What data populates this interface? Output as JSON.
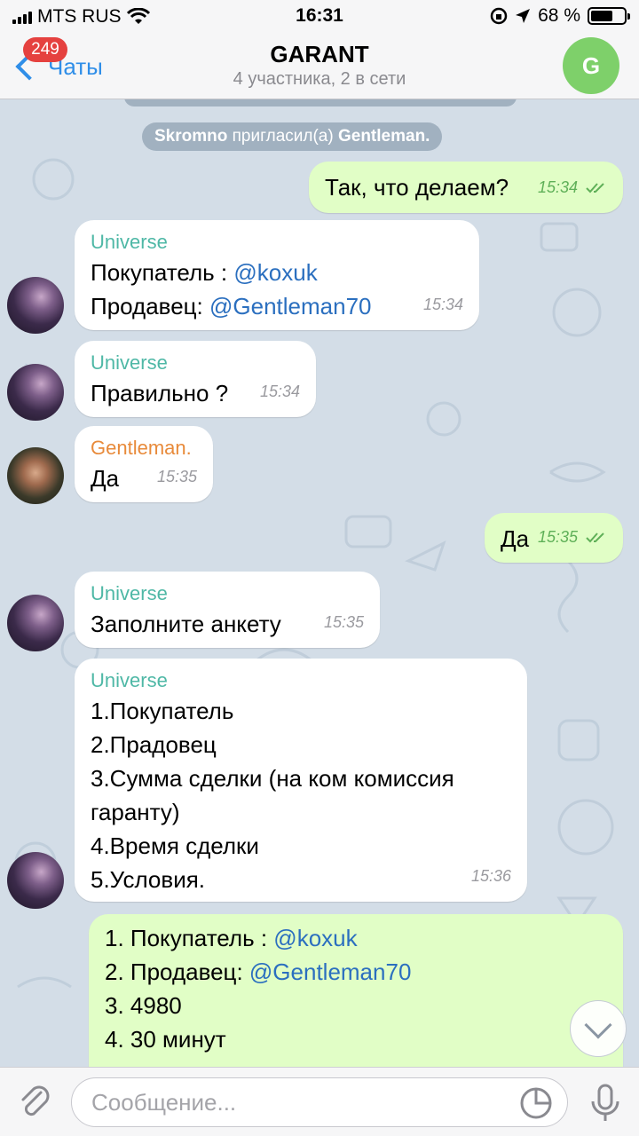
{
  "status_bar": {
    "carrier": "MTS RUS",
    "time": "16:31",
    "battery": "68 %",
    "battery_level": 0.68
  },
  "header": {
    "back_label": "Чаты",
    "unread_count": "249",
    "title": "GARANT",
    "subtitle": "4 участника, 2 в сети",
    "avatar_letter": "G",
    "avatar_color": "#7ed06a"
  },
  "service_messages": [
    {
      "actor": "Skromno",
      "action": "пригласил(а)",
      "target": "Gentleman."
    }
  ],
  "messages": [
    {
      "direction": "out",
      "text": "Так, что делаем?",
      "time": "15:34",
      "read": true
    },
    {
      "direction": "in",
      "sender": "Universe",
      "line1_prefix": "Покупатель : ",
      "line1_link": "@koxuk",
      "line2_prefix": "Продавец: ",
      "line2_link": "@Gentleman70",
      "time": "15:34"
    },
    {
      "direction": "in",
      "sender": "Universe",
      "text": "Правильно ?",
      "time": "15:34"
    },
    {
      "direction": "in",
      "sender": "Gentleman.",
      "text": "Да",
      "time": "15:35"
    },
    {
      "direction": "out",
      "text": "Да",
      "time": "15:35",
      "read": true
    },
    {
      "direction": "in",
      "sender": "Universe",
      "text": "Заполните анкету",
      "time": "15:35"
    },
    {
      "direction": "in",
      "sender": "Universe",
      "lines": [
        "1.Покупатель",
        "2.Прадовец",
        "3.Сумма сделки (на ком комиссия",
        "гаранту)",
        "4.Время сделки",
        "5.Условия."
      ],
      "time": "15:36"
    },
    {
      "direction": "out",
      "line1_prefix": "1. Покупатель : ",
      "line1_link": "@koxuk",
      "line2_prefix": "2. Продавец: ",
      "line2_link": "@Gentleman70",
      "line3": "3. 4980",
      "line4": "4. 30 минут"
    }
  ],
  "input": {
    "placeholder": "Сообщение..."
  },
  "colors": {
    "accent": "#2f8ee8",
    "outgoing_bubble": "#e1fec6",
    "universe_name": "#4fb8a6",
    "gentleman_name": "#e88a3a",
    "link": "#2b6fbf"
  },
  "icons": {
    "attach": "paperclip-icon",
    "sticker": "sticker-icon",
    "mic": "microphone-icon",
    "scroll": "chevron-down-icon",
    "read": "double-check-icon"
  }
}
